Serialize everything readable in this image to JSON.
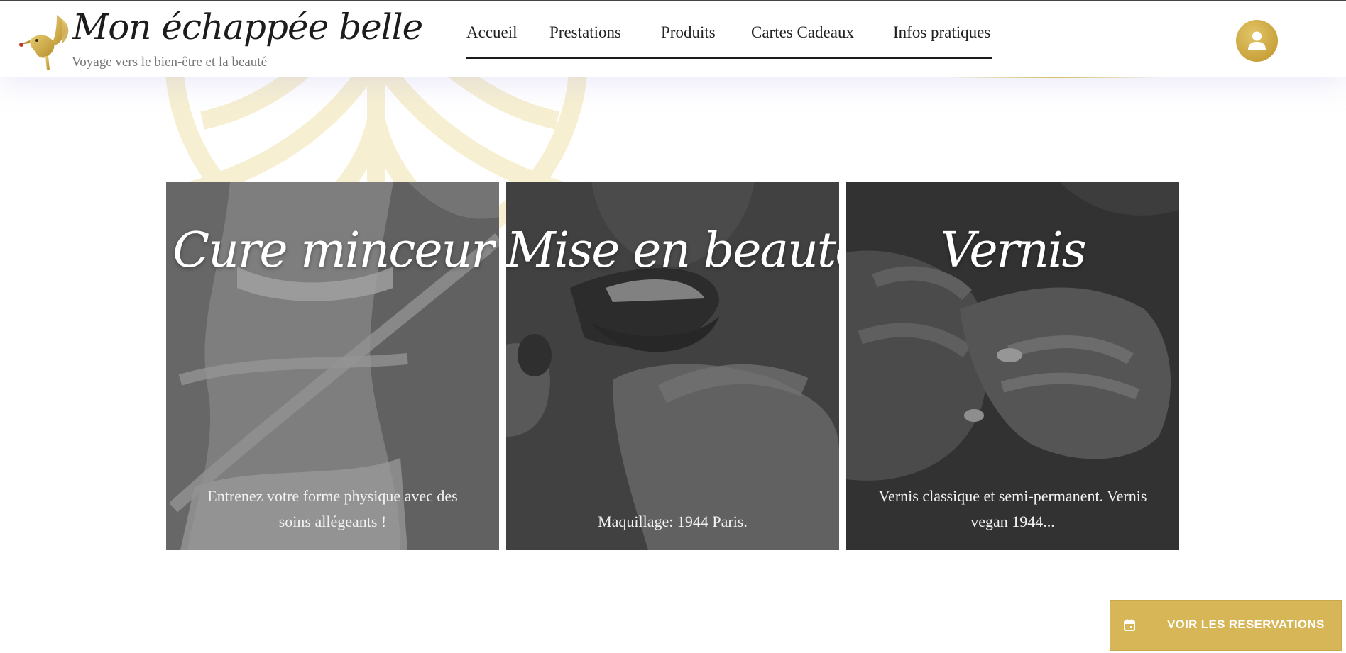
{
  "brand": {
    "title": "Mon échappée belle",
    "tagline": "Voyage vers le bien-être et la beauté",
    "logo_icon": "hummingbird-icon"
  },
  "nav": {
    "items": [
      {
        "label": "Accueil"
      },
      {
        "label": "Prestations"
      },
      {
        "label": "Produits"
      },
      {
        "label": "Cartes Cadeaux"
      },
      {
        "label": "Infos pratiques"
      }
    ]
  },
  "header": {
    "account_icon": "user-icon"
  },
  "cards": [
    {
      "title": "Cure minceur",
      "description": "Entrenez votre forme physique avec des soins allégeants !",
      "image": "measuring-tape-waist-photo"
    },
    {
      "title": "Mise en beauté",
      "description": "Maquillage: 1944 Paris.",
      "image": "lips-makeup-photo"
    },
    {
      "title": "Vernis",
      "description": "Vernis classique et semi-permanent. Vernis vegan 1944...",
      "image": "nail-polish-hands-photo"
    }
  ],
  "reservation": {
    "label": "VOIR LES RESERVATIONS",
    "icon": "calendar-icon"
  },
  "colors": {
    "gold": "#d6b657",
    "text_dark": "#222222",
    "card_overlay": "#555555"
  }
}
